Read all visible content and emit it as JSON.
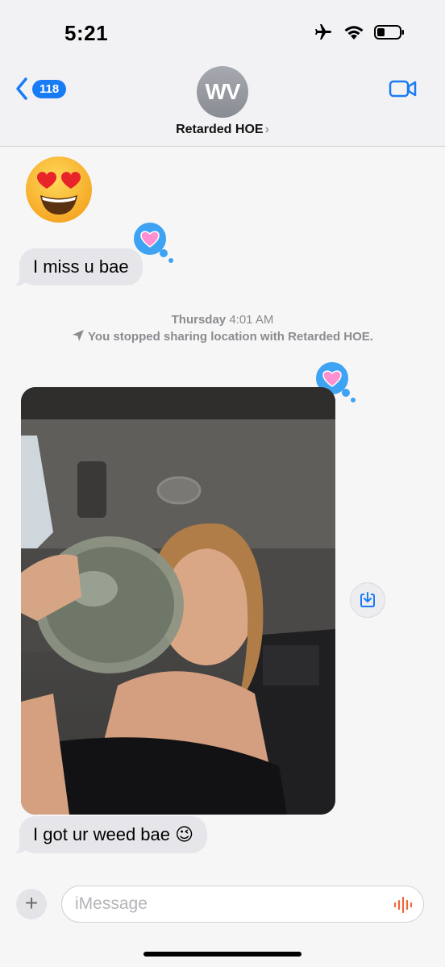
{
  "status_bar": {
    "time": "5:21"
  },
  "header": {
    "back_count": "118",
    "avatar_initials": "WV",
    "contact_name": "Retarded HOE",
    "contact_chevron": "›"
  },
  "messages": {
    "emoji_message": "😍",
    "message_1": "I miss u bae",
    "timestamp_day": "Thursday",
    "timestamp_time": "4:01 AM",
    "location_note": "You stopped sharing location with Retarded HOE.",
    "message_2": "I got ur weed bae 😉",
    "tapback_reaction": "💗"
  },
  "compose": {
    "plus_label": "+",
    "placeholder": "iMessage"
  },
  "colors": {
    "accent": "#1a7cf5",
    "incoming_bubble": "#e6e6ea",
    "tapback": "#3ea3f3"
  },
  "icons": [
    "airplane-icon",
    "wifi-icon",
    "battery-icon",
    "back-chevron-icon",
    "video-call-icon",
    "location-arrow-icon",
    "save-download-icon",
    "audio-waveform-icon",
    "heart-tapback-icon"
  ]
}
